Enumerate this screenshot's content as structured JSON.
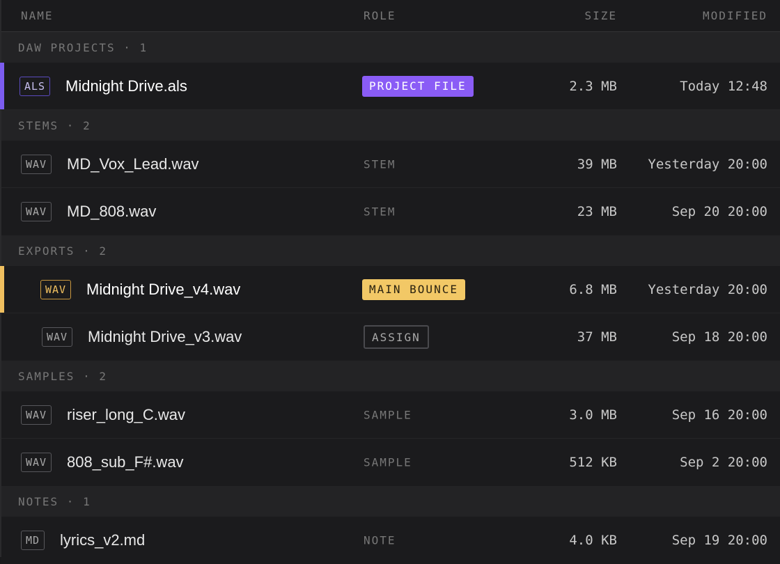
{
  "header": {
    "name": "NAME",
    "role": "ROLE",
    "size": "SIZE",
    "modified": "MODIFIED"
  },
  "groups": {
    "daw": {
      "label": "DAW PROJECTS · 1"
    },
    "stems": {
      "label": "STEMS · 2"
    },
    "exports": {
      "label": "EXPORTS · 2"
    },
    "samples": {
      "label": "SAMPLES · 2"
    },
    "notes": {
      "label": "NOTES · 1"
    }
  },
  "files": [
    {
      "ext": "ALS",
      "name": "Midnight Drive.als",
      "role": "PROJECT FILE",
      "size": "2.3 MB",
      "modified": "Today 12:48"
    },
    {
      "ext": "WAV",
      "name": "MD_Vox_Lead.wav",
      "role": "STEM",
      "size": "39 MB",
      "modified": "Yesterday 20:00"
    },
    {
      "ext": "WAV",
      "name": "MD_808.wav",
      "role": "STEM",
      "size": "23 MB",
      "modified": "Sep 20 20:00"
    },
    {
      "ext": "WAV",
      "name": "Midnight Drive_v4.wav",
      "role": "MAIN BOUNCE",
      "size": "6.8 MB",
      "modified": "Yesterday 20:00"
    },
    {
      "ext": "WAV",
      "name": "Midnight Drive_v3.wav",
      "role": "ASSIGN",
      "size": "37 MB",
      "modified": "Sep 18 20:00"
    },
    {
      "ext": "WAV",
      "name": "riser_long_C.wav",
      "role": "SAMPLE",
      "size": "3.0 MB",
      "modified": "Sep 16 20:00"
    },
    {
      "ext": "WAV",
      "name": "808_sub_F#.wav",
      "role": "SAMPLE",
      "size": "512 KB",
      "modified": "Sep 2 20:00"
    },
    {
      "ext": "MD",
      "name": "lyrics_v2.md",
      "role": "NOTE",
      "size": "4.0 KB",
      "modified": "Sep 19 20:00"
    }
  ],
  "colors": {
    "accent_purple": "#8a5cf6",
    "accent_yellow": "#f2c866",
    "background": "#1b1b1d"
  }
}
